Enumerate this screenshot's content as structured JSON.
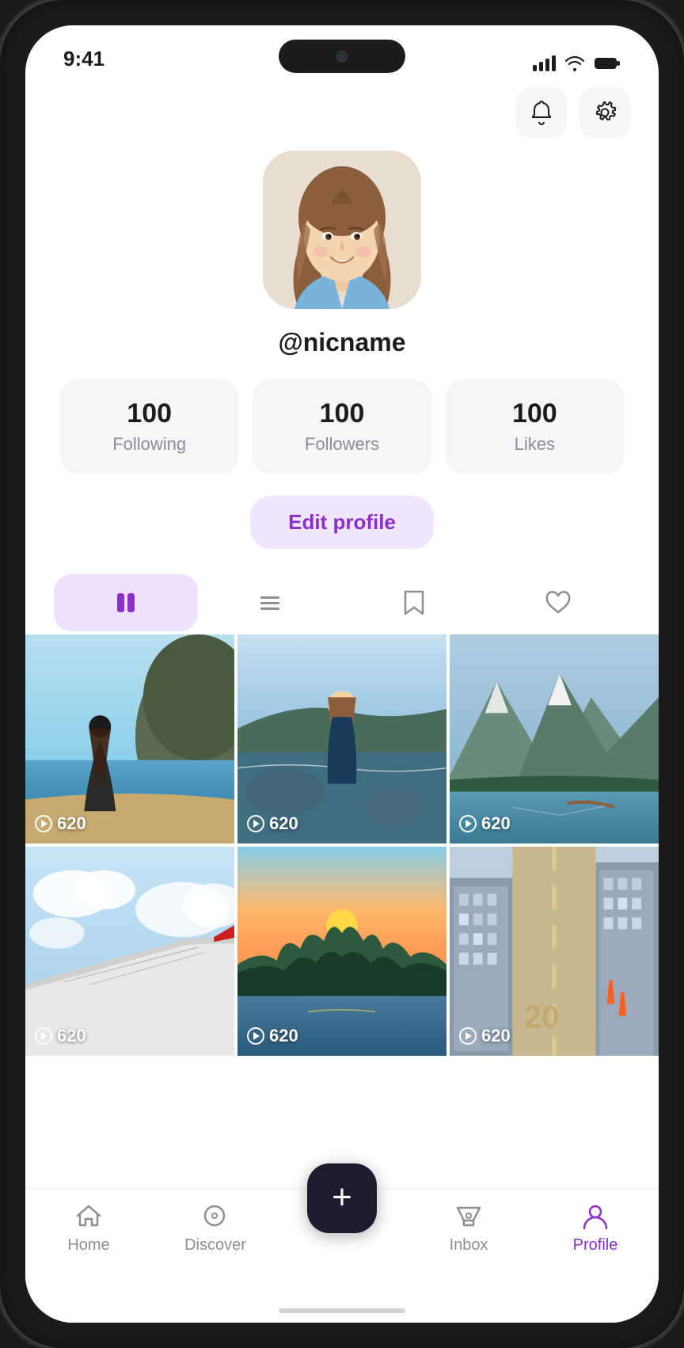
{
  "status": {
    "time": "9:41"
  },
  "header": {
    "notification_label": "notification",
    "settings_label": "settings"
  },
  "profile": {
    "username": "@nicname",
    "avatar_alt": "Profile photo - smiling young woman",
    "stats": [
      {
        "count": "100",
        "label": "Following"
      },
      {
        "count": "100",
        "label": "Followers"
      },
      {
        "count": "100",
        "label": "Likes"
      }
    ],
    "edit_button": "Edit profile"
  },
  "content_tabs": [
    {
      "id": "videos",
      "active": true
    },
    {
      "id": "posts",
      "active": false
    },
    {
      "id": "saved",
      "active": false
    },
    {
      "id": "liked",
      "active": false
    }
  ],
  "grid_items": [
    {
      "id": 1,
      "views": "620",
      "type": "beach"
    },
    {
      "id": 2,
      "views": "620",
      "type": "coast"
    },
    {
      "id": 3,
      "views": "620",
      "type": "mountain"
    },
    {
      "id": 4,
      "views": "620",
      "type": "plane"
    },
    {
      "id": 5,
      "views": "620",
      "type": "forest"
    },
    {
      "id": 6,
      "views": "620",
      "type": "city"
    }
  ],
  "bottom_nav": [
    {
      "id": "home",
      "label": "Home",
      "active": false
    },
    {
      "id": "discover",
      "label": "Discover",
      "active": false
    },
    {
      "id": "add",
      "label": "",
      "active": false
    },
    {
      "id": "inbox",
      "label": "Inbox",
      "active": false
    },
    {
      "id": "profile",
      "label": "Profile",
      "active": true
    }
  ]
}
